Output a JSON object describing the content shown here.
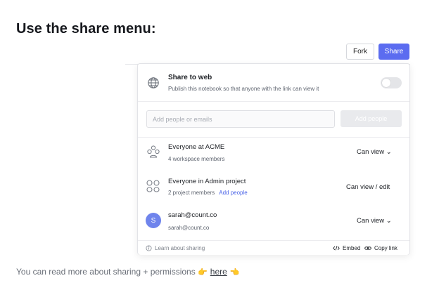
{
  "heading": "Use the share menu:",
  "toolbar": {
    "fork_label": "Fork",
    "share_label": "Share"
  },
  "share_to_web": {
    "title": "Share to web",
    "description": "Publish this notebook so that anyone with the link can view it",
    "enabled": false
  },
  "invite": {
    "placeholder": "Add people or emails",
    "button_label": "Add people"
  },
  "members": [
    {
      "icon": "workspace-group-icon",
      "name": "Everyone at ACME",
      "sub": "4 workspace members",
      "permission": "Can view ⌄"
    },
    {
      "icon": "project-group-icon",
      "name": "Everyone in Admin project",
      "sub": "2 project members",
      "link": "Add people",
      "permission": "Can view / edit"
    },
    {
      "icon": "avatar",
      "avatar_letter": "S",
      "name": "sarah@count.co",
      "sub": "sarah@count.co",
      "permission": "Can view ⌄"
    }
  ],
  "footer": {
    "learn": "Learn about sharing",
    "embed": "Embed",
    "copy_link": "Copy link"
  },
  "bottom": {
    "text_before": "You can read more about sharing + permissions",
    "link": "here",
    "emoji_before": "👉",
    "emoji_after": "👈"
  },
  "colors": {
    "accent": "#5b6cf0",
    "link": "#4a63e7",
    "avatar": "#6f84ec"
  }
}
